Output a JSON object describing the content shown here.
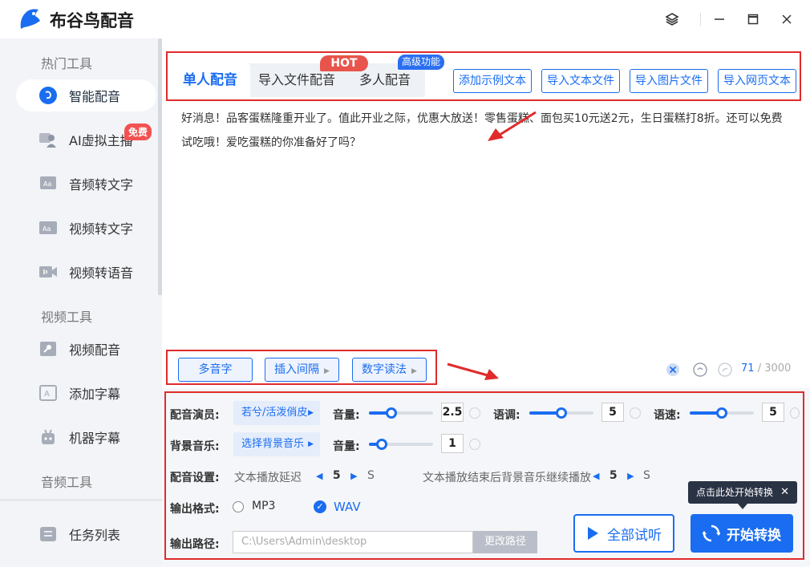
{
  "app": {
    "title": "布谷鸟配音"
  },
  "sidebar": {
    "sections": [
      "热门工具",
      "视频工具",
      "音频工具"
    ],
    "items": [
      {
        "label": "智能配音",
        "icon": "smart-dub-icon",
        "active": true
      },
      {
        "label": "AI虚拟主播",
        "icon": "virtual-anchor-icon"
      },
      {
        "label": "音频转文字",
        "icon": "audio-to-text-icon"
      },
      {
        "label": "视频转文字",
        "icon": "video-to-text-icon"
      },
      {
        "label": "视频转语音",
        "icon": "video-to-voice-icon"
      },
      {
        "label": "视频配音",
        "icon": "video-dub-icon"
      },
      {
        "label": "添加字幕",
        "icon": "subtitle-icon"
      },
      {
        "label": "机器字幕",
        "icon": "robot-subtitle-icon"
      },
      {
        "label": "任务列表",
        "icon": "task-list-icon"
      }
    ],
    "free_badge": "免费"
  },
  "tabs": {
    "single": "单人配音",
    "import_file": "导入文件配音",
    "multi": "多人配音",
    "hot_badge": "HOT",
    "adv_badge": "高级功能"
  },
  "toolbar": {
    "add_sample": "添加示例文本",
    "import_text": "导入文本文件",
    "import_image": "导入图片文件",
    "import_web": "导入网页文本"
  },
  "editor": {
    "text": "好消息！品客蛋糕隆重开业了。值此开业之际，优惠大放送！零售蛋糕、面包买10元送2元，生日蛋糕打8折。还可以免费试吃哦！爱吃蛋糕的你准备好了吗？",
    "count": "71",
    "max": "/ 3000"
  },
  "insert": {
    "polyphone": "多音字",
    "pause": "插入间隔",
    "number": "数字读法"
  },
  "settings": {
    "voice_label": "配音演员:",
    "voice_value": "若兮/活泼俏皮",
    "volume_label": "音量:",
    "volume_value": "2.5",
    "volume_fraction": 0.35,
    "pitch_label": "语调:",
    "pitch_value": "5",
    "pitch_fraction": 0.5,
    "speed_label": "语速:",
    "speed_value": "5",
    "speed_fraction": 0.5,
    "bgm_label": "背景音乐:",
    "bgm_value": "选择背景音乐",
    "bgm_volume_label": "音量:",
    "bgm_volume_value": "1",
    "bgm_volume_fraction": 0.2,
    "dub_label": "配音设置:",
    "delay_label": "文本播放延迟",
    "delay_value": "5",
    "delay_unit": "S",
    "continue_label": "文本播放结束后背景音乐继续播放",
    "continue_value": "5",
    "continue_unit": "S",
    "format_label": "输出格式:",
    "format_mp3": "MP3",
    "format_wav": "WAV",
    "selected_format": "WAV",
    "path_label": "输出路径:",
    "path_value": "C:\\Users\\Admin\\desktop",
    "change_path": "更改路径"
  },
  "actions": {
    "listen_all": "全部试听",
    "start": "开始转换",
    "tooltip": "点击此处开始转换"
  },
  "colors": {
    "accent": "#1a6df0",
    "highlight": "#e02b2b",
    "sidebar_bg": "#f2f4f8"
  }
}
